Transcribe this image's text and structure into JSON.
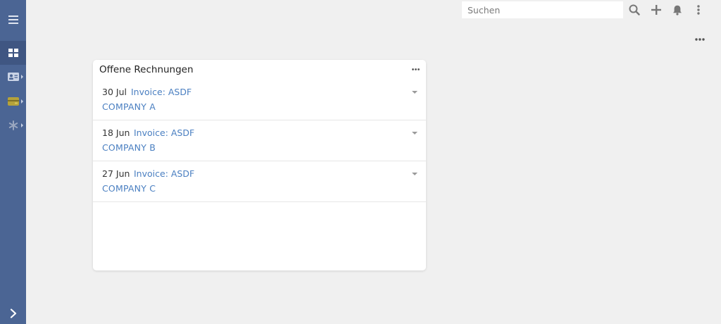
{
  "search": {
    "placeholder": "Suchen",
    "value": ""
  },
  "topbar": {
    "icons": [
      "search-icon",
      "plus-icon",
      "bell-icon",
      "kebab-menu-icon"
    ]
  },
  "sidebar": {
    "items": [
      {
        "name": "menu",
        "icon": "hamburger-icon"
      },
      {
        "name": "dashboard",
        "icon": "dashboard-icon",
        "active": true
      },
      {
        "name": "contacts",
        "icon": "contact-card-icon"
      },
      {
        "name": "finance",
        "icon": "wallet-icon"
      },
      {
        "name": "admin",
        "icon": "asterisk-icon"
      },
      {
        "name": "expand",
        "icon": "chevron-right-icon"
      }
    ]
  },
  "dashlet": {
    "title": "Offene Rechnungen",
    "rows": [
      {
        "date": "30 Jul",
        "invoice": "Invoice: ASDF",
        "company": "COMPANY A"
      },
      {
        "date": "18 Jun",
        "invoice": "Invoice: ASDF",
        "company": "COMPANY B"
      },
      {
        "date": "27 Jun",
        "invoice": "Invoice: ASDF",
        "company": "COMPANY C"
      }
    ]
  },
  "colors": {
    "sidebar": "#4b6594",
    "sidebar_active": "#3f5682",
    "link": "#4a7fc1",
    "background": "#f0f0f0",
    "wallet": "#b5a23a",
    "asterisk": "#9aa7bf"
  }
}
